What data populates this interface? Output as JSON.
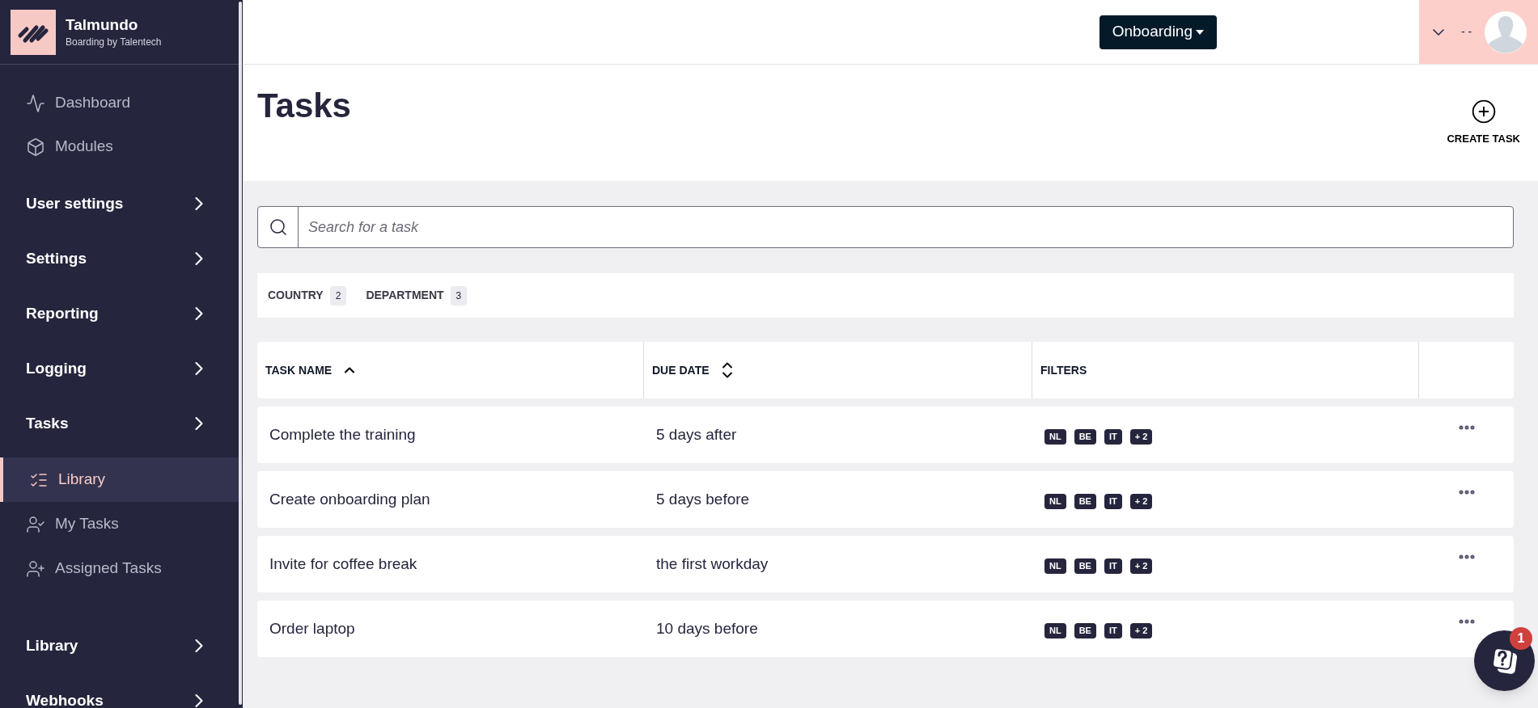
{
  "brand": {
    "name": "Talmundo",
    "tagline": "Boarding by Talentech"
  },
  "sidebar": {
    "items": [
      {
        "kind": "link",
        "label": "Dashboard",
        "selected": false
      },
      {
        "kind": "link",
        "label": "Modules",
        "selected": false
      },
      {
        "kind": "section",
        "label": "User settings"
      },
      {
        "kind": "section",
        "label": "Settings"
      },
      {
        "kind": "section",
        "label": "Reporting"
      },
      {
        "kind": "section",
        "label": "Logging"
      },
      {
        "kind": "section",
        "label": "Tasks",
        "children": [
          {
            "label": "Library",
            "selected": true
          },
          {
            "label": "My Tasks",
            "selected": false
          },
          {
            "label": "Assigned Tasks",
            "selected": false
          }
        ]
      },
      {
        "kind": "section",
        "label": "Library"
      },
      {
        "kind": "section",
        "label": "Webhooks"
      }
    ]
  },
  "header": {
    "module_button": "Onboarding",
    "user_name": "- -"
  },
  "page": {
    "title": "Tasks",
    "create_button": "CREATE TASK"
  },
  "search": {
    "placeholder": "Search for a task"
  },
  "filters": [
    {
      "label": "COUNTRY",
      "count": "2"
    },
    {
      "label": "DEPARTMENT",
      "count": "3"
    }
  ],
  "table": {
    "columns": [
      {
        "label": "TASK NAME",
        "kind": "sorted"
      },
      {
        "label": "DUE DATE",
        "kind": "sortable"
      },
      {
        "label": "FILTERS",
        "kind": "plain"
      }
    ],
    "rows": [
      {
        "name": "Complete the training",
        "due": "5 days after",
        "tags": [
          "NL",
          "BE",
          "IT",
          "+ 2"
        ]
      },
      {
        "name": "Create onboarding plan",
        "due": "5 days before",
        "tags": [
          "NL",
          "BE",
          "IT",
          "+ 2"
        ]
      },
      {
        "name": "Invite for coffee break",
        "due": "the first workday",
        "tags": [
          "NL",
          "BE",
          "IT",
          "+ 2"
        ]
      },
      {
        "name": "Order laptop",
        "due": "10 days before",
        "tags": [
          "NL",
          "BE",
          "IT",
          "+ 2"
        ]
      }
    ]
  },
  "help": {
    "badge": "1"
  }
}
